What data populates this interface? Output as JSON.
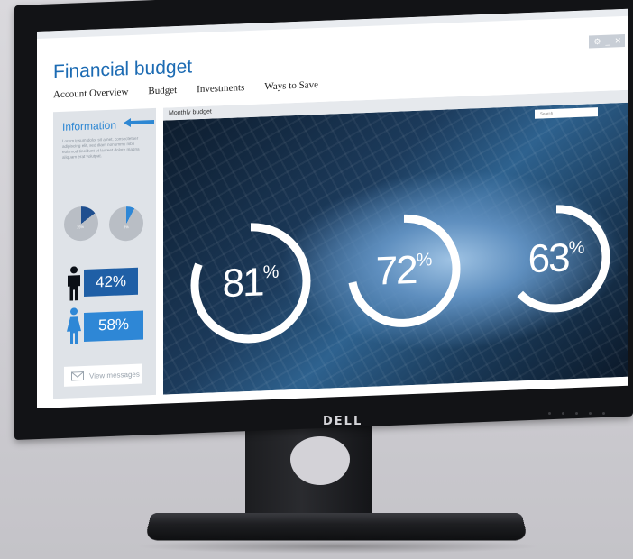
{
  "monitor": {
    "brand": "DELL"
  },
  "app": {
    "title": "Financial budget",
    "window_controls": [
      "⚙",
      "_",
      "✕"
    ],
    "tabs": [
      "Account Overview",
      "Budget",
      "Investments",
      "Ways to Save"
    ]
  },
  "sidebar": {
    "heading": "Information",
    "body_text": "Lorem ipsum dolor sit amet, consectetuer adipiscing elit, sed diam nonummy nibh euismod tincidunt ut laoreet dolore magna aliquam erat volutpat.",
    "pies": [
      {
        "label": "15%",
        "value": 15
      },
      {
        "label": "8%",
        "value": 8
      }
    ],
    "stats": [
      {
        "icon": "male-person-icon",
        "value": "42%",
        "color": "#1f5fa6"
      },
      {
        "icon": "female-person-icon",
        "value": "58%",
        "color": "#2e87d6"
      }
    ],
    "messages_button": "View messages"
  },
  "main": {
    "header": "Monthly budget",
    "search_placeholder": "Search",
    "rings": [
      {
        "number": "81",
        "suffix": "%",
        "value": 81
      },
      {
        "number": "72",
        "suffix": "%",
        "value": 72
      },
      {
        "number": "63",
        "suffix": "%",
        "value": 63
      }
    ]
  },
  "colors": {
    "accent": "#1c6bb3",
    "sidebar_bg": "#dfe3e8",
    "bezel": "#121316"
  }
}
